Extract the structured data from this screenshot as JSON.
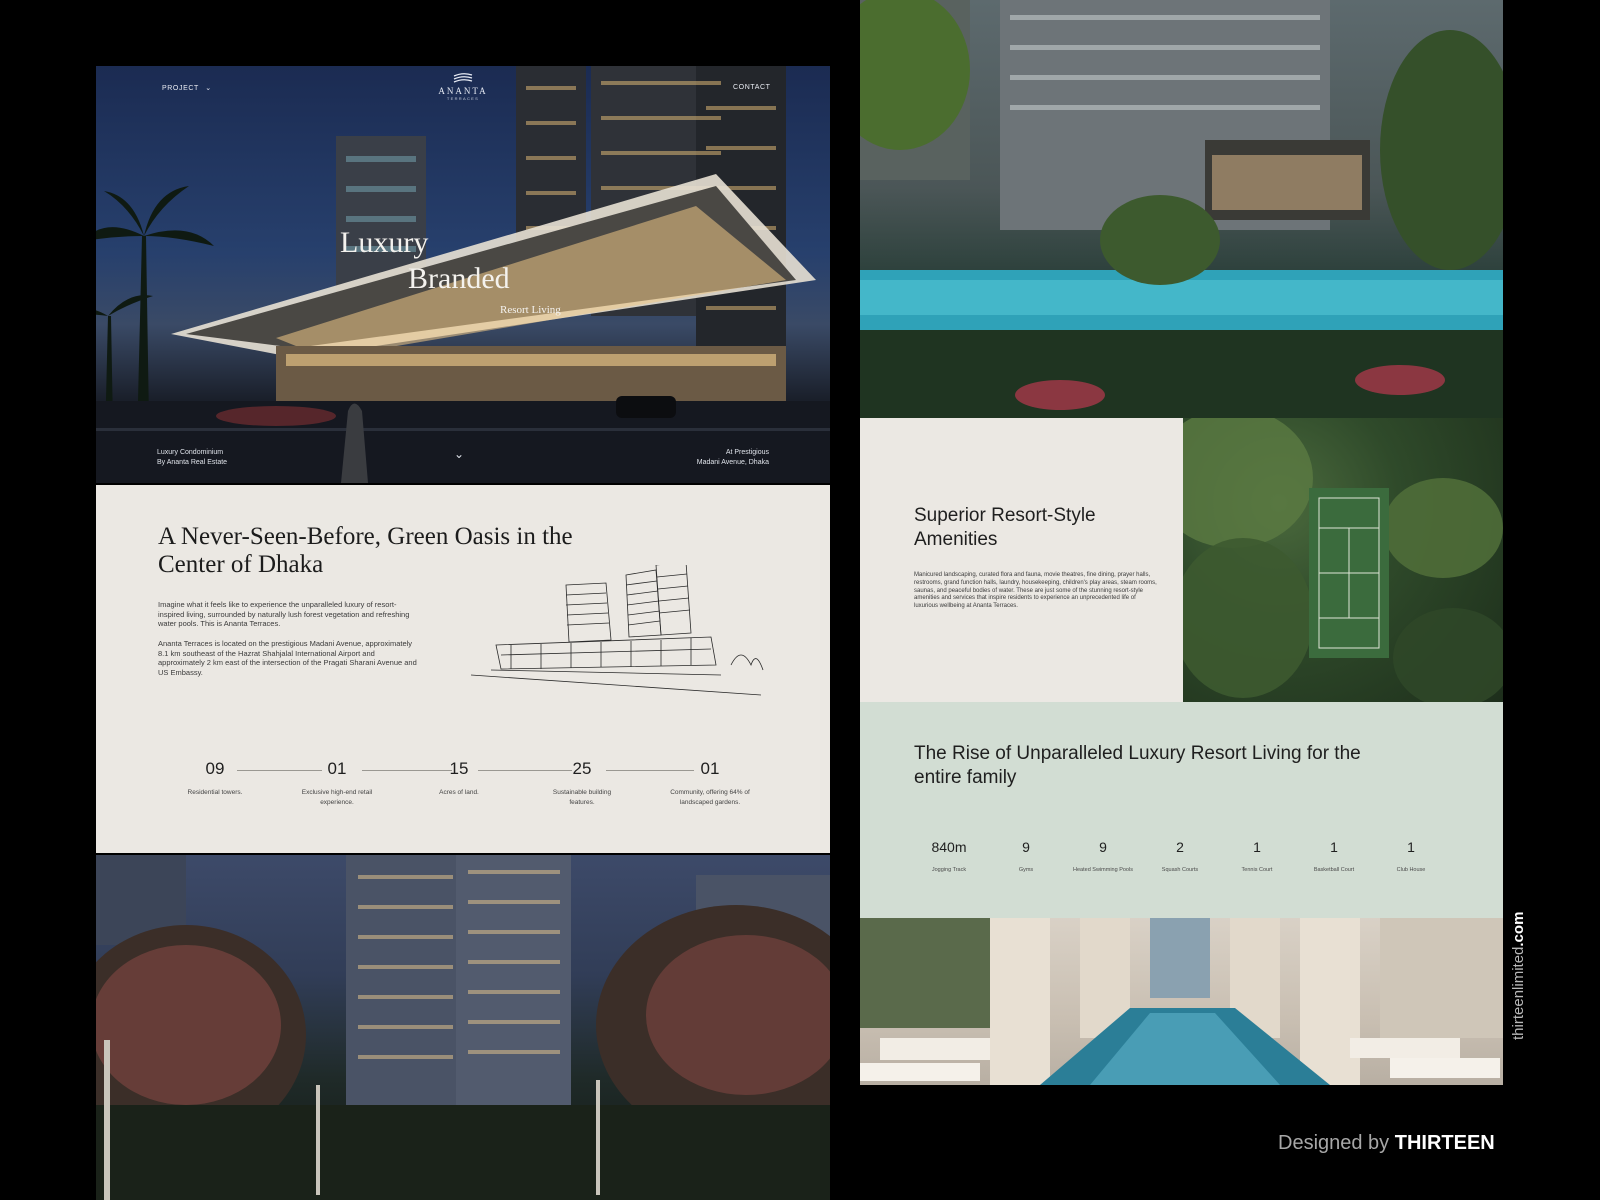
{
  "hero": {
    "nav_project": "PROJECT",
    "nav_contact": "CONTACT",
    "logo_name": "ANANTA",
    "logo_sub": "TERRACES",
    "headline_1": "Luxury",
    "headline_2": "Branded",
    "headline_3": "Resort Living",
    "foot_left_1": "Luxury Condominium",
    "foot_left_2": "By Ananta Real Estate",
    "foot_right_1": "At Prestigious",
    "foot_right_2": "Madani Avenue, Dhaka"
  },
  "intro": {
    "title": "A Never-Seen-Before, Green Oasis in the Center of Dhaka",
    "para1": "Imagine what it feels like to experience the unparalleled luxury of resort-inspired living, surrounded by naturally lush forest vegetation and refreshing water pools. This is Ananta Terraces.",
    "para2": "Ananta Terraces is located on the prestigious Madani Avenue, approximately 8.1 km southeast of the Hazrat Shahjalal International Airport and approximately 2 km east of the intersection of the Pragati Sharani Avenue and US Embassy.",
    "stats": [
      {
        "num": "09",
        "label": "Residential towers."
      },
      {
        "num": "01",
        "label": "Exclusive high-end retail experience."
      },
      {
        "num": "15",
        "label": "Acres of land."
      },
      {
        "num": "25",
        "label": "Sustainable building features."
      },
      {
        "num": "01",
        "label": "Community, offering 64% of landscaped gardens."
      }
    ]
  },
  "amenities": {
    "title": "Superior Resort-Style Amenities",
    "body": "Manicured landscaping, curated flora and fauna, movie theatres, fine dining, prayer halls, restrooms, grand function halls, laundry, housekeeping, children's play areas, steam rooms, saunas, and peaceful bodies of water. These are just some of the stunning resort-style amenities and services that inspire residents to experience an unprecedented life of luxurious wellbeing at Ananta Terraces."
  },
  "rise": {
    "title": "The Rise of Unparalleled Luxury Resort Living for the entire family",
    "stats": [
      {
        "num": "840m",
        "label": "Jogging Track"
      },
      {
        "num": "9",
        "label": "Gyms"
      },
      {
        "num": "9",
        "label": "Heated Swimming Pools"
      },
      {
        "num": "2",
        "label": "Squash Courts"
      },
      {
        "num": "1",
        "label": "Tennis Court"
      },
      {
        "num": "1",
        "label": "Basketball Court"
      },
      {
        "num": "1",
        "label": "Club House"
      }
    ]
  },
  "credit": {
    "prefix": "Designed by ",
    "brand": "THIRTEEN",
    "site_prefix": "thirteenlimited",
    "site_suffix": ".com"
  }
}
